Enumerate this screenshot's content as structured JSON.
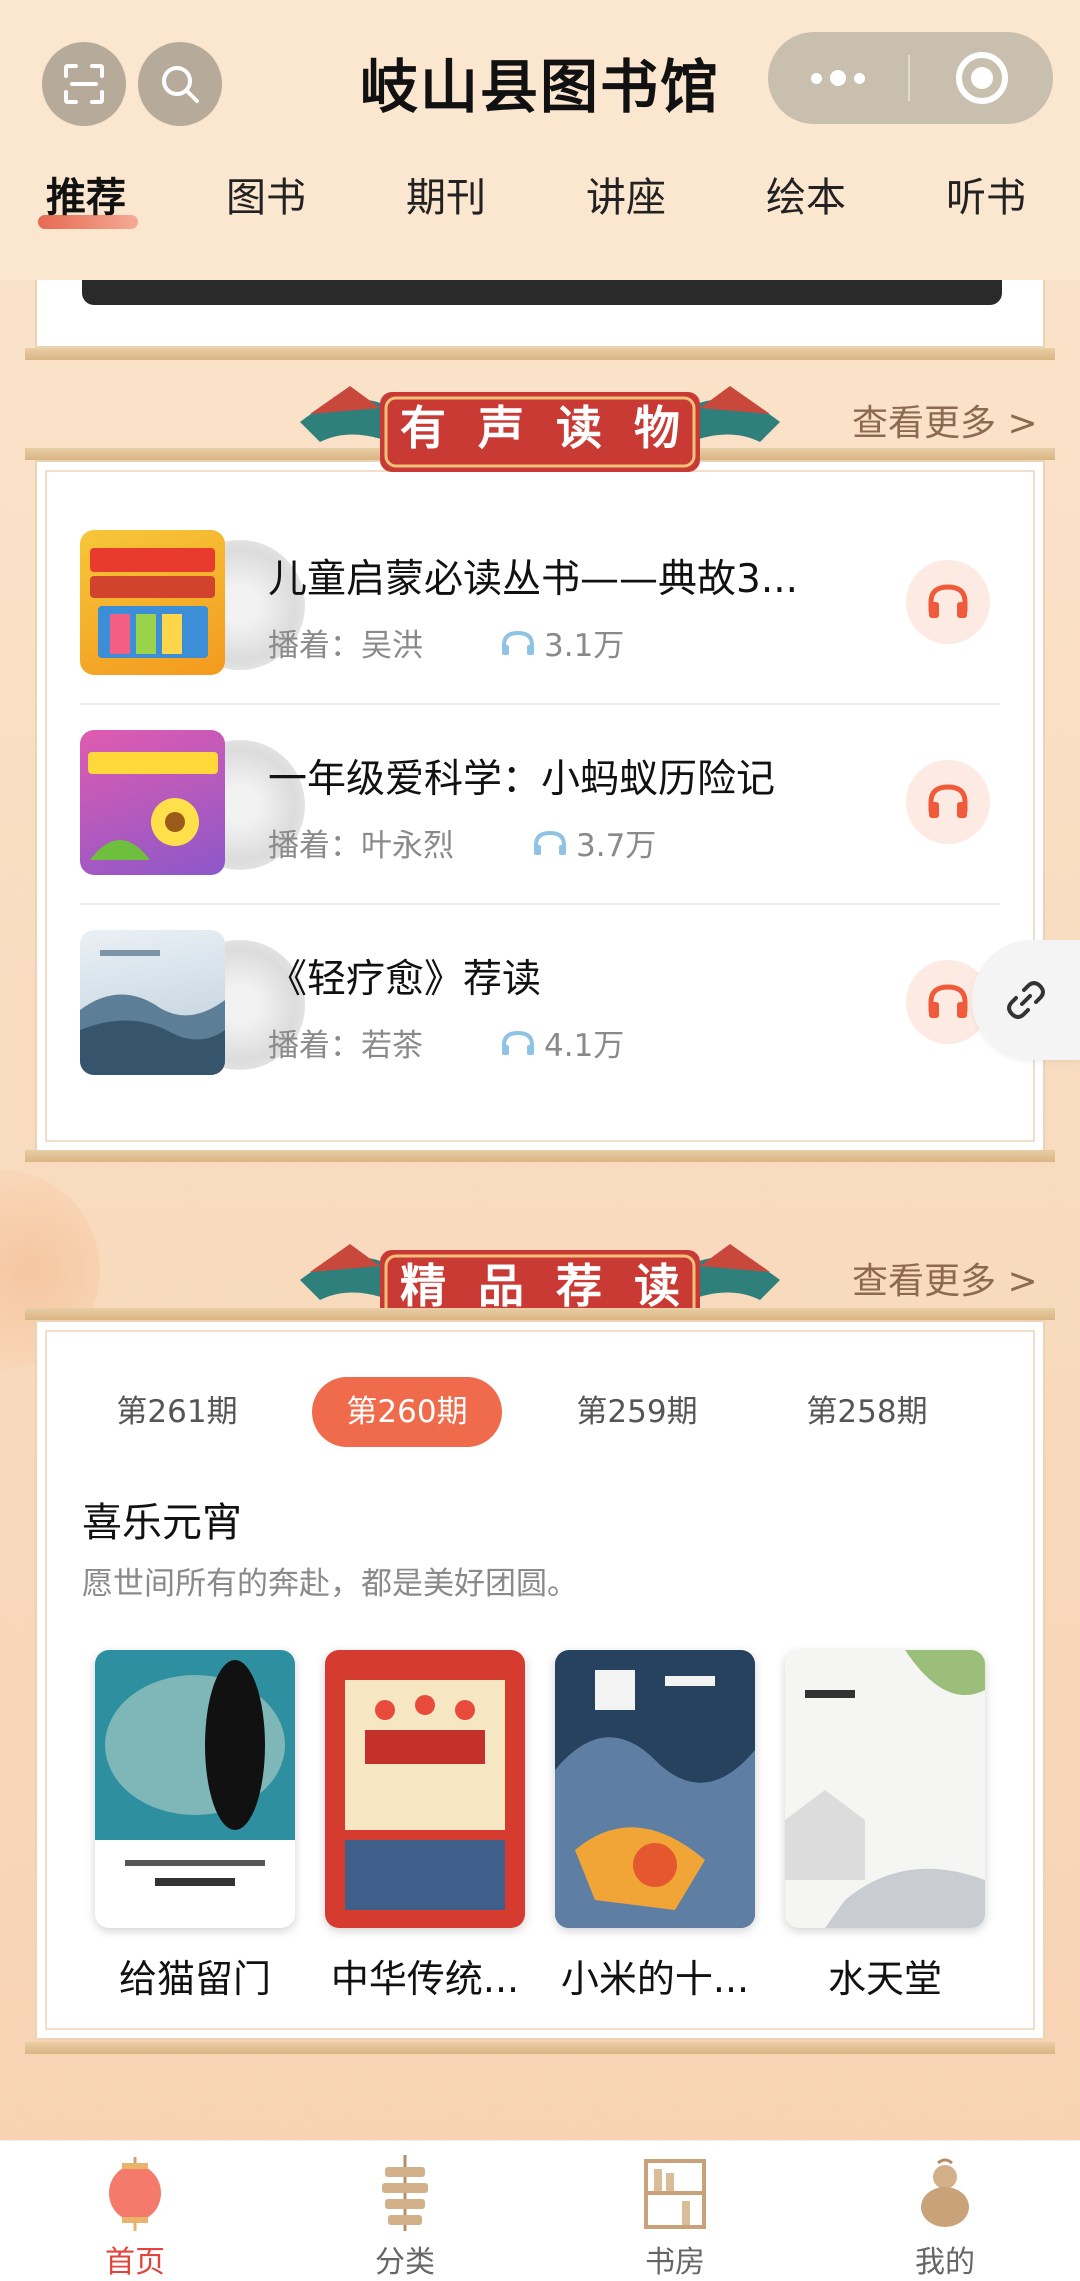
{
  "header": {
    "title": "岐山县图书馆"
  },
  "tabs": [
    {
      "label": "推荐"
    },
    {
      "label": "图书"
    },
    {
      "label": "期刊"
    },
    {
      "label": "讲座"
    },
    {
      "label": "绘本"
    },
    {
      "label": "听书"
    }
  ],
  "audio_section": {
    "banner_chars": [
      "有",
      "声",
      "读",
      "物"
    ],
    "more": "查看更多 >",
    "items": [
      {
        "title": "儿童启蒙必读丛书——典故3...",
        "narrator": "播着：吴洪",
        "plays": "3.1万"
      },
      {
        "title": "一年级爱科学：小蚂蚁历险记",
        "narrator": "播着：叶永烈",
        "plays": "3.7万"
      },
      {
        "title": "《轻疗愈》荐读",
        "narrator": "播着：若茶",
        "plays": "4.1万"
      }
    ]
  },
  "rec_section": {
    "banner_chars": [
      "精",
      "品",
      "荐",
      "读"
    ],
    "more": "查看更多 >",
    "issues": [
      "第261期",
      "第260期",
      "第259期",
      "第258期"
    ],
    "active_issue": "第260期",
    "title": "喜乐元宵",
    "subtitle": "愿世间所有的奔赴，都是美好团圆。",
    "books": [
      {
        "name": "给猫留门"
      },
      {
        "name": "中华传统..."
      },
      {
        "name": "小米的十..."
      },
      {
        "name": "水天堂"
      }
    ]
  },
  "bottom_nav": [
    {
      "label": "首页"
    },
    {
      "label": "分类"
    },
    {
      "label": "书房"
    },
    {
      "label": "我的"
    }
  ],
  "colors": {
    "accent": "#ef6b4c",
    "bg": "#fbe6cf",
    "active_nav": "#e0443a"
  }
}
